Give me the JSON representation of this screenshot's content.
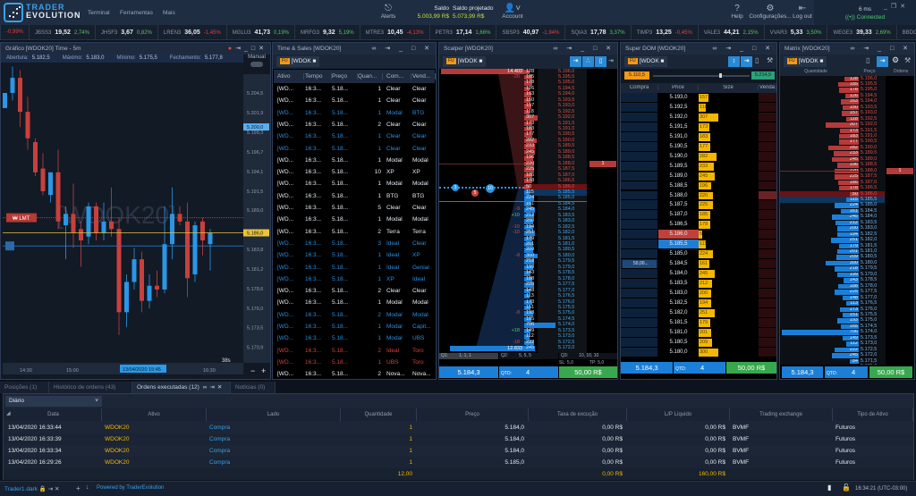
{
  "header": {
    "brand_top": "TRADER",
    "brand_bottom": "EVOLUTION",
    "menu": [
      "Terminal",
      "Ferramentas",
      "Mais"
    ],
    "alerts": "Alerts",
    "saldo_label": "Saldo",
    "saldo_value": "5.003,99 R$",
    "saldo_proj_label": "Saldo projetado",
    "saldo_proj_value": "5.073,99 R$",
    "account": "Account",
    "help": "Help",
    "settings": "Configurações...",
    "logout": "Log out",
    "latency": "6 ms",
    "connection": "Connected",
    "colors": {
      "accent": "#3aa0e8",
      "balance": "#c6e03a",
      "connected": "#4fce6a"
    }
  },
  "ticker": [
    {
      "sym": "",
      "price": "",
      "chg": "-0,99%",
      "dir": "dn"
    },
    {
      "sym": "JBSS3",
      "price": "19,52",
      "chg": "2,74%",
      "dir": "up"
    },
    {
      "sym": "JHSF3",
      "price": "3,67",
      "chg": "0,82%",
      "dir": "up"
    },
    {
      "sym": "LREN3",
      "price": "36,05",
      "chg": "-1,45%",
      "dir": "dn"
    },
    {
      "sym": "MGLU3",
      "price": "41,73",
      "chg": "0,19%",
      "dir": "up"
    },
    {
      "sym": "MRFG3",
      "price": "9,32",
      "chg": "5,19%",
      "dir": "up"
    },
    {
      "sym": "MTRE3",
      "price": "10,45",
      "chg": "-4,13%",
      "dir": "dn"
    },
    {
      "sym": "PETR3",
      "price": "17,14",
      "chg": "1,66%",
      "dir": "up"
    },
    {
      "sym": "SBSP3",
      "price": "40,97",
      "chg": "-1,94%",
      "dir": "dn"
    },
    {
      "sym": "SQIA3",
      "price": "17,78",
      "chg": "3,37%",
      "dir": "up"
    },
    {
      "sym": "TIMP3",
      "price": "13,25",
      "chg": "-0,45%",
      "dir": "dn"
    },
    {
      "sym": "VALE3",
      "price": "44,21",
      "chg": "2,15%",
      "dir": "up"
    },
    {
      "sym": "VVAR3",
      "price": "5,33",
      "chg": "3,50%",
      "dir": "up"
    },
    {
      "sym": "WEGE3",
      "price": "39,33",
      "chg": "2,69%",
      "dir": "up"
    },
    {
      "sym": "BBDC4",
      "price": "22,73",
      "chg": "1,52%",
      "dir": "up"
    }
  ],
  "chart": {
    "title": "Gráfico [WDOK20] Time - 5m",
    "info": [
      {
        "k": "Abertura:",
        "v": "5.182,5"
      },
      {
        "k": "Máximo:",
        "v": "5.183,0"
      },
      {
        "k": "Mínimo:",
        "v": "5.175,5"
      },
      {
        "k": "Fechamento:",
        "v": "5.177,8"
      }
    ],
    "mode": "Manual",
    "watermark": "[WDOK20]",
    "price_labels": [
      "5.204,5",
      "5.201,9",
      "5.199,3",
      "5.196,7",
      "5.194,1",
      "5.191,5",
      "5.189,0",
      "5.183,8",
      "5.181,2",
      "5.178,6",
      "5.176,0",
      "5.173,5",
      "5.170,9"
    ],
    "highlight_label": "5.200,0",
    "current_price": "5.186,0",
    "time_labels": [
      "14:30",
      "15:00",
      "16:30"
    ],
    "crosshair_time": "13/04/2020 15:45",
    "countdown": "38s",
    "order_label": "LMT",
    "order_price": 5188.0,
    "position_price": 5184.5,
    "last_price": 5186.0,
    "colors": {
      "up": "#2b96e6",
      "down": "#c8403c",
      "last": "#e8c53a"
    },
    "candles": [
      [
        5202.5,
        5204.5,
        5202.5,
        5204.5
      ],
      [
        5204.5,
        5208,
        5203.5,
        5206.5
      ],
      [
        5206.5,
        5207.5,
        5200,
        5202
      ],
      [
        5202,
        5204,
        5197,
        5198.5
      ],
      [
        5198,
        5198.5,
        5193.5,
        5194
      ],
      [
        5194.5,
        5196.5,
        5191,
        5191.5
      ],
      [
        5191,
        5194,
        5190,
        5194
      ],
      [
        5194,
        5197,
        5186.5,
        5187.5
      ],
      [
        5187,
        5189.5,
        5182.5,
        5188.5
      ],
      [
        5188.5,
        5192.5,
        5184,
        5186
      ],
      [
        5186.5,
        5187.5,
        5181.5,
        5185
      ],
      [
        5185.5,
        5190,
        5184.5,
        5189.5
      ],
      [
        5189.5,
        5190,
        5185,
        5186
      ],
      [
        5186,
        5190,
        5185,
        5187.5
      ],
      [
        5187.5,
        5192,
        5185.5,
        5186.5
      ],
      [
        5186.5,
        5188,
        5172.5,
        5175.5
      ],
      [
        5175.5,
        5180.5,
        5173.5,
        5179.5
      ],
      [
        5179.5,
        5184,
        5178.5,
        5182.5
      ],
      [
        5182.5,
        5183.5,
        5175.5,
        5177
      ],
      [
        5177,
        5180.5,
        5176,
        5179
      ],
      [
        5179,
        5181,
        5177.5,
        5178.5
      ],
      [
        5178.5,
        5189.5,
        5178,
        5184.5
      ],
      [
        5184.5,
        5192,
        5182.5,
        5188.5
      ],
      [
        5188.5,
        5189.5,
        5187,
        5187.5
      ],
      [
        5187.5,
        5190,
        5177.5,
        5180
      ],
      [
        5180.5,
        5187.5,
        5179.5,
        5187
      ],
      [
        5187.5,
        5188,
        5183,
        5185
      ],
      [
        5184.5,
        5186.5,
        5181,
        5186
      ]
    ]
  },
  "tns": {
    "title": "Time & Sales [WDOK20]",
    "badge": "FU",
    "symbol": "[WDOK",
    "columns": [
      "Ativo",
      "Tempo",
      "Preço",
      "Quan...",
      "Com...",
      "Vend..."
    ],
    "rows": [
      [
        "[WD...",
        "16:3...",
        "5.18...",
        "1",
        "Clear",
        "Clear",
        "w"
      ],
      [
        "[WD...",
        "16:3...",
        "5.18...",
        "1",
        "Clear",
        "Clear",
        "w"
      ],
      [
        "[WD...",
        "16:3...",
        "5.18...",
        "1",
        "Modal",
        "BTG",
        "b"
      ],
      [
        "[WD...",
        "16:3...",
        "5.18...",
        "2",
        "Clear",
        "Clear",
        "w"
      ],
      [
        "[WD...",
        "16:3...",
        "5.18...",
        "1",
        "Clear",
        "Clear",
        "b"
      ],
      [
        "[WD...",
        "16:3...",
        "5.18...",
        "1",
        "Clear",
        "Clear",
        "b"
      ],
      [
        "[WD...",
        "16:3...",
        "5.18...",
        "1",
        "Modal",
        "Modal",
        "w"
      ],
      [
        "[WD...",
        "16:3...",
        "5.18...",
        "10",
        "XP",
        "XP",
        "w"
      ],
      [
        "[WD...",
        "16:3...",
        "5.18...",
        "1",
        "Modal",
        "Modal",
        "w"
      ],
      [
        "[WD...",
        "16:3...",
        "5.18...",
        "1",
        "BTG",
        "BTG",
        "w"
      ],
      [
        "[WD...",
        "16:3...",
        "5.18...",
        "5",
        "Clear",
        "Clear",
        "w"
      ],
      [
        "[WD...",
        "16:3...",
        "5.18...",
        "1",
        "Modal",
        "Modal",
        "w"
      ],
      [
        "[WD...",
        "16:3...",
        "5.18...",
        "2",
        "Terra",
        "Terra",
        "w"
      ],
      [
        "[WD...",
        "16:3...",
        "5.18...",
        "3",
        "Ideal",
        "Clear",
        "b"
      ],
      [
        "[WD...",
        "16:3...",
        "5.18...",
        "1",
        "Ideal",
        "XP",
        "b"
      ],
      [
        "[WD...",
        "16:3...",
        "5.18...",
        "1",
        "Ideal",
        "Genial",
        "b"
      ],
      [
        "[WD...",
        "16:3...",
        "5.18...",
        "1",
        "XP",
        "Ideal",
        "b"
      ],
      [
        "[WD...",
        "16:3...",
        "5.18...",
        "2",
        "Clear",
        "Clear",
        "w"
      ],
      [
        "[WD...",
        "16:3...",
        "5.18...",
        "1",
        "Modal",
        "Modal",
        "w"
      ],
      [
        "[WD...",
        "16:3...",
        "5.18...",
        "2",
        "Modal",
        "Modal",
        "b"
      ],
      [
        "[WD...",
        "16:3...",
        "5.18...",
        "1",
        "Modal",
        "Capit...",
        "b"
      ],
      [
        "[WD...",
        "16:3...",
        "5.18...",
        "1",
        "Modal",
        "UBS",
        "b"
      ],
      [
        "[WD...",
        "16:3...",
        "5.18...",
        "2",
        "Ideal",
        "Toro",
        "r"
      ],
      [
        "[WD...",
        "16:3...",
        "5.18...",
        "1",
        "UBS",
        "Toro",
        "r"
      ],
      [
        "[WD...",
        "16:3...",
        "5.18...",
        "2",
        "Nova...",
        "Nova...",
        "w"
      ]
    ],
    "colors": {
      "w": "#e6ecf3",
      "b": "#2b8fe0",
      "r": "#d9403c"
    }
  },
  "book": {
    "asks": [
      [
        "5.196,0",
        128
      ],
      [
        "5.195,5",
        185
      ],
      [
        "5.195,0",
        178
      ],
      [
        "5.194,5",
        126
      ],
      [
        "5.194,0",
        163
      ],
      [
        "5.193,5",
        150
      ],
      [
        "5.193,0",
        157
      ],
      [
        "5.192,5",
        118
      ],
      [
        "5.192,0",
        307
      ],
      [
        "5.191,5",
        173
      ],
      [
        "5.191,0",
        183
      ],
      [
        "5.190,5",
        177
      ],
      [
        "5.190,0",
        282
      ],
      [
        "5.189,5",
        233
      ],
      [
        "5.189,0",
        245
      ],
      [
        "5.188,5",
        196
      ],
      [
        "5.188,0",
        220
      ],
      [
        "5.187,5",
        225
      ],
      [
        "5.187,0",
        185
      ],
      [
        "5.186,5",
        178
      ],
      [
        "5.186,0",
        50
      ]
    ],
    "bids": [
      [
        "5.185,5",
        115
      ],
      [
        "5.185,0",
        224
      ],
      [
        "5.184,5",
        161
      ],
      [
        "5.184,0",
        245
      ],
      [
        "5.183,5",
        212
      ],
      [
        "5.183,0",
        200
      ],
      [
        "5.182,5",
        194
      ],
      [
        "5.182,0",
        251
      ],
      [
        "5.181,5",
        179
      ],
      [
        "5.181,0",
        201
      ],
      [
        "5.180,5",
        209
      ],
      [
        "5.180,0",
        300
      ],
      [
        "5.179,5",
        218
      ],
      [
        "5.179,0",
        199
      ],
      [
        "5.178,5",
        143
      ],
      [
        "5.178,0",
        188
      ],
      [
        "5.177,5",
        225
      ],
      [
        "5.177,0",
        148
      ],
      [
        "5.176,5",
        113
      ],
      [
        "5.176,0",
        173
      ],
      [
        "5.175,5",
        151
      ],
      [
        "5.175,0",
        193
      ],
      [
        "5.174,5",
        165
      ],
      [
        "5.174,0",
        706
      ],
      [
        "5.173,5",
        149
      ],
      [
        "5.173,0",
        112
      ],
      [
        "5.172,5",
        222
      ],
      [
        "5.172,0",
        245
      ],
      [
        "5.171,5",
        84
      ],
      [
        "5.171,0",
        104
      ]
    ],
    "working_order": {
      "price": "5.188,0",
      "qty": "1"
    }
  },
  "scalper": {
    "title": "Scalper [WDOK20]",
    "badge": "FU",
    "symbol": "[WDOK",
    "cum_top": "14.403",
    "cum_bottom": "12.833",
    "deltas": [
      [
        "5.195,5",
        "-20"
      ],
      [
        "5.184,0",
        "-9"
      ],
      [
        "5.183,5",
        "+10"
      ],
      [
        "5.182,5",
        "-10"
      ],
      [
        "5.182,0",
        "-10"
      ],
      [
        "5.180,0",
        "-8"
      ],
      [
        "5.175,0",
        "-8"
      ],
      [
        "5.173,5",
        "+18"
      ],
      [
        "5.172,5",
        "-18"
      ]
    ],
    "bubbles": [
      "3",
      "10",
      "5"
    ],
    "q1": "Q1:",
    "q1v": "1, 1, 1",
    "q2": "Q2:",
    "q2v": "5, 5, 5",
    "q3": "Q3:",
    "q3v": "10, 10, 10",
    "sl": "SL: 5,0",
    "tp": "TP: 5,0",
    "price": "5.184,3",
    "qtd_label": "QTD:",
    "qtd": "4",
    "amount": "50,00 R$"
  },
  "superdom": {
    "title": "Super DOM [WDOK20]",
    "badge": "FU",
    "symbol": "[WDOK",
    "range_low": "5.110,5",
    "range_high": "5.214,5",
    "columns": [
      "Compra",
      "Price",
      "Size",
      "Venda"
    ],
    "position": "50,00...",
    "price": "5.184,3",
    "qtd_label": "QTD:",
    "qtd": "4",
    "amount": "50,00 R$"
  },
  "matrix": {
    "title": "Matrix [WDOK20]",
    "badge": "FU",
    "symbol": "[WDOK",
    "columns": [
      "Quantidade",
      "Preço",
      "Ordens"
    ],
    "price": "5.184,3",
    "qtd_label": "QTD:",
    "qtd": "4",
    "amount": "50,00 R$"
  },
  "bottom": {
    "tabs": [
      {
        "label": "Posições (1)",
        "active": false
      },
      {
        "label": "Histórico de ordens (43)",
        "active": false
      },
      {
        "label": "Ordens executadas (12)",
        "active": true
      },
      {
        "label": "Notícias (0)",
        "active": false
      }
    ],
    "period": "Diário",
    "columns": [
      "Data",
      "Ativo",
      "Lado",
      "Quantidade",
      "Preço",
      "Taxa de excução",
      "L/P Líquido",
      "Trading exchange",
      "Tipo de Ativo"
    ],
    "rows": [
      [
        "13/04/2020 16:33:44",
        "WDOK20",
        "Compra",
        "1",
        "5.184,0",
        "0,00 R$",
        "0,00 R$",
        "BVMF",
        "Futuros"
      ],
      [
        "13/04/2020 16:33:39",
        "WDOK20",
        "Compra",
        "1",
        "5.184,0",
        "0,00 R$",
        "0,00 R$",
        "BVMF",
        "Futuros"
      ],
      [
        "13/04/2020 16:33:34",
        "WDOK20",
        "Compra",
        "1",
        "5.184,0",
        "0,00 R$",
        "0,00 R$",
        "BVMF",
        "Futuros"
      ],
      [
        "13/04/2020 16:29:26",
        "WDOK20",
        "Compra",
        "1",
        "5.185,0",
        "0,00 R$",
        "0,00 R$",
        "BVMF",
        "Futuros"
      ]
    ],
    "totals": {
      "quantity": "12,00",
      "fee": "0,00 R$",
      "pl": "160,00 R$"
    }
  },
  "status": {
    "workspace": "Trader1.dark",
    "powered": "Powered by TraderEvolution",
    "clock": "16:34:21 (UTC-03:00)"
  }
}
